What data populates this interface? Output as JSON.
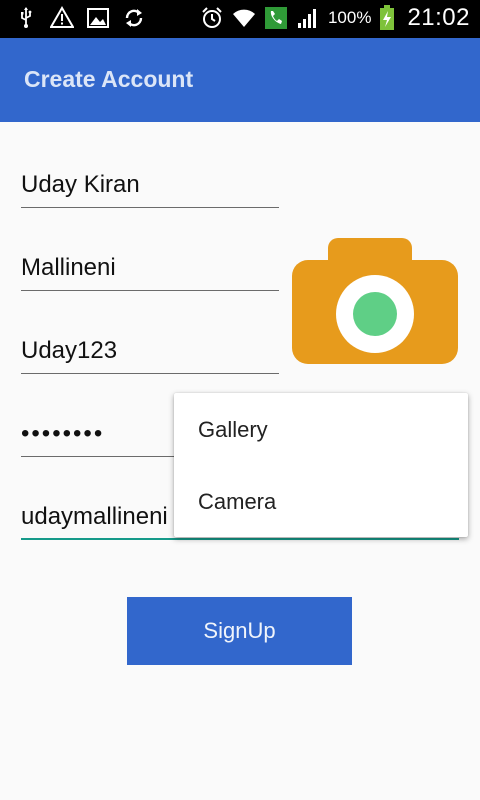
{
  "statusbar": {
    "icons_left": [
      "usb-icon",
      "warning-icon",
      "image-icon",
      "sync-icon"
    ],
    "icons_right": [
      "alarm-icon",
      "wifi-icon",
      "phone-icon",
      "signal-icon"
    ],
    "battery_percent": "100%",
    "time": "21:02"
  },
  "appbar": {
    "title": "Create Account"
  },
  "form": {
    "first_name": "Uday Kiran",
    "last_name": "Mallineni",
    "username": "Uday123",
    "password": "••••••••",
    "email": "udaymallineni"
  },
  "popup": {
    "items": [
      "Gallery",
      "Camera"
    ]
  },
  "buttons": {
    "signup_label": "SignUp"
  },
  "colors": {
    "primary": "#3267cc",
    "camera_body": "#e79b1c",
    "lens_green": "#5fcf86",
    "focus_underline": "#169a8a"
  }
}
